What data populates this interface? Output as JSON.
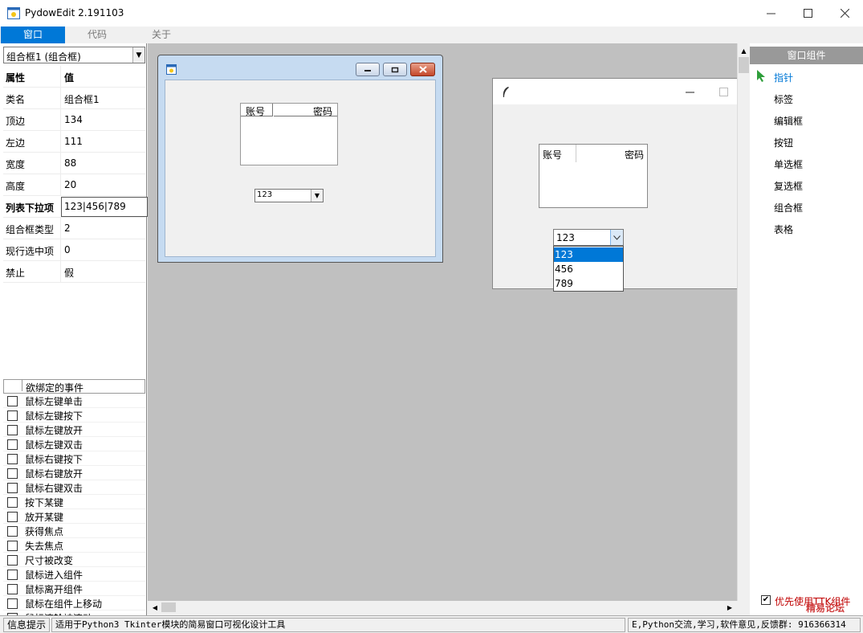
{
  "window": {
    "title": "PydowEdit  2.191103"
  },
  "menu": {
    "tabs": [
      "窗口",
      "代码",
      "关于"
    ]
  },
  "left_panel": {
    "component_select": "组合框1 (组合框)",
    "prop_header": {
      "key": "属性",
      "value": "值"
    },
    "props": [
      {
        "key": "类名",
        "value": "组合框1"
      },
      {
        "key": "顶边",
        "value": "134"
      },
      {
        "key": "左边",
        "value": "111"
      },
      {
        "key": "宽度",
        "value": "88"
      },
      {
        "key": "高度",
        "value": "20"
      },
      {
        "key": "列表下拉项",
        "value": "123|456|789"
      },
      {
        "key": "组合框类型",
        "value": "2"
      },
      {
        "key": "现行选中项",
        "value": "0"
      },
      {
        "key": "禁止",
        "value": "假"
      }
    ],
    "events_header": "欲绑定的事件",
    "events": [
      "鼠标左键单击",
      "鼠标左键按下",
      "鼠标左键放开",
      "鼠标左键双击",
      "鼠标右键按下",
      "鼠标右键放开",
      "鼠标右键双击",
      "按下某键",
      "放开某键",
      "获得焦点",
      "失去焦点",
      "尺寸被改变",
      "鼠标进入组件",
      "鼠标离开组件",
      "鼠标在组件上移动",
      "鼠标滚轮被滚动"
    ]
  },
  "design_window": {
    "listbox_cols": [
      "账号",
      "密码"
    ],
    "combo_value": "123"
  },
  "preview_window": {
    "listbox_cols": [
      "账号",
      "密码"
    ],
    "combo_value": "123",
    "dropdown_options": [
      "123",
      "456",
      "789"
    ],
    "selected_option": "123"
  },
  "right_panel": {
    "header": "窗口组件",
    "items": [
      "指针",
      "标签",
      "编辑框",
      "按钮",
      "单选框",
      "复选框",
      "组合框",
      "表格"
    ],
    "ttk_checkbox": "优先使用TTK组件",
    "watermark": "精易论坛"
  },
  "status": {
    "label": "信息提示",
    "message": "适用于Python3 Tkinter模块的简易窗口可视化设计工具",
    "right": "E,Python交流,学习,软件意见,反馈群: 916366314"
  },
  "colors": {
    "accent": "#0078d7",
    "canvas": "#c0c0c0",
    "selection": "#0078d7"
  }
}
